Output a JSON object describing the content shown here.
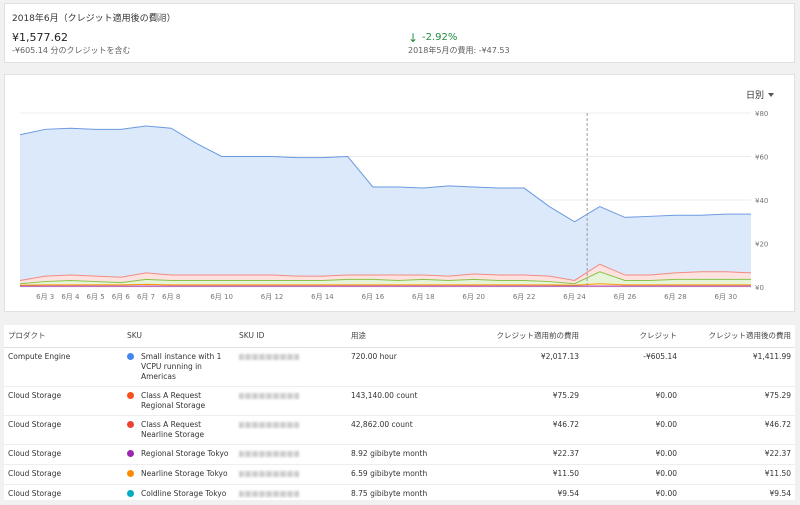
{
  "summary": {
    "title": "2018年6月（クレジット適用後の費用）",
    "help_icon": "help-icon",
    "total": "¥1,577.62",
    "credit_note": "-¥605.14 分のクレジットを含む",
    "change": "-2.92%",
    "change_icon": "arrow-down-icon",
    "previous": "2018年5月の費用: -¥47.53"
  },
  "chart": {
    "granularity_label": "日別",
    "forecast_divider_x": 24.5
  },
  "chart_data": {
    "type": "area",
    "x": [
      2,
      3,
      4,
      5,
      6,
      7,
      8,
      9,
      10,
      11,
      12,
      13,
      14,
      15,
      16,
      17,
      18,
      19,
      20,
      21,
      22,
      23,
      24,
      25,
      26,
      27,
      28,
      29,
      30,
      31
    ],
    "x_tick_labels": [
      "6月 3",
      "6月 4",
      "6月 5",
      "6月 6",
      "6月 7",
      "6月 8",
      "6月 10",
      "6月 12",
      "6月 14",
      "6月 16",
      "6月 18",
      "6月 20",
      "6月 22",
      "6月 24",
      "6月 26",
      "6月 28",
      "6月 30"
    ],
    "x_tick_values": [
      3,
      4,
      5,
      6,
      7,
      8,
      10,
      12,
      14,
      16,
      18,
      20,
      22,
      24,
      26,
      28,
      30
    ],
    "ylim": [
      0,
      80
    ],
    "y_ticks": [
      0,
      20,
      40,
      60,
      80
    ],
    "y_tick_labels": [
      "¥0",
      "¥20",
      "¥40",
      "¥60",
      "¥80"
    ],
    "series": [
      {
        "color": "#6b9ae0",
        "fill": "#dce9fb",
        "values": [
          70,
          72.5,
          73,
          72.5,
          72.5,
          74,
          73,
          66,
          60,
          60,
          60,
          59.5,
          59.5,
          60,
          46,
          46,
          45.5,
          46.5,
          46,
          45.5,
          45.5,
          37,
          30,
          37,
          32,
          32.5,
          33,
          33,
          33.5,
          33.5
        ]
      },
      {
        "color": "#f28b82",
        "fill": "#fde2df",
        "values": [
          3,
          5,
          5.5,
          5,
          4.5,
          6.5,
          5.5,
          5.5,
          5.5,
          5.5,
          5.5,
          5,
          5,
          5.5,
          5.5,
          5.5,
          5.5,
          5,
          6,
          5.5,
          5.5,
          5,
          3,
          10.5,
          5.5,
          5.5,
          6.5,
          7,
          7,
          6.5
        ]
      },
      {
        "color": "#8bc34a",
        "fill": "#e6f4d7",
        "values": [
          1.5,
          2.5,
          3,
          2.5,
          2,
          3.5,
          3,
          3,
          3,
          3,
          3,
          3,
          3,
          3.5,
          3.5,
          3,
          3.5,
          3,
          3.5,
          3,
          3,
          2.5,
          1.5,
          7,
          3,
          3,
          3.5,
          3.5,
          3.5,
          3.5
        ]
      },
      {
        "color": "#ff9800",
        "fill": "#fff3e0",
        "values": [
          0.8,
          1,
          1,
          1,
          1,
          1.2,
          1,
          1,
          1,
          1,
          1,
          1,
          1,
          1,
          1,
          1,
          1,
          1,
          1,
          1,
          1,
          1,
          0.8,
          1.5,
          1,
          1,
          1,
          1,
          1,
          1
        ]
      },
      {
        "color": "#9c27b0",
        "fill": "none",
        "values": [
          0.4,
          0.4,
          0.4,
          0.4,
          0.4,
          0.4,
          0.4,
          0.4,
          0.4,
          0.4,
          0.4,
          0.4,
          0.4,
          0.4,
          0.4,
          0.4,
          0.4,
          0.4,
          0.4,
          0.4,
          0.4,
          0.4,
          0.4,
          0.4,
          0.4,
          0.4,
          0.4,
          0.4,
          0.4,
          0.4
        ]
      }
    ]
  },
  "table": {
    "headers": [
      "プロダクト",
      "SKU",
      "SKU ID",
      "用途",
      "クレジット適用前の費用",
      "クレジット",
      "クレジット適用後の費用"
    ],
    "rows": [
      {
        "product": "Compute Engine",
        "dot": "#4285f4",
        "sku": "Small instance with 1 VCPU running in Americas",
        "usage": "720.00 hour",
        "before": "¥2,017.13",
        "credit": "-¥605.14",
        "after": "¥1,411.99"
      },
      {
        "product": "Cloud Storage",
        "dot": "#f4511e",
        "sku": "Class A Request Regional Storage",
        "usage": "143,140.00 count",
        "before": "¥75.29",
        "credit": "¥0.00",
        "after": "¥75.29"
      },
      {
        "product": "Cloud Storage",
        "dot": "#ea4335",
        "sku": "Class A Request Nearline Storage",
        "usage": "42,862.00 count",
        "before": "¥46.72",
        "credit": "¥0.00",
        "after": "¥46.72"
      },
      {
        "product": "Cloud Storage",
        "dot": "#9c27b0",
        "sku": "Regional Storage Tokyo",
        "usage": "8.92 gibibyte month",
        "before": "¥22.37",
        "credit": "¥0.00",
        "after": "¥22.37"
      },
      {
        "product": "Cloud Storage",
        "dot": "#fb8c00",
        "sku": "Nearline Storage Tokyo",
        "usage": "6.59 gibibyte month",
        "before": "¥11.50",
        "credit": "¥0.00",
        "after": "¥11.50"
      },
      {
        "product": "Cloud Storage",
        "dot": "#00acc1",
        "sku": "Coldline Storage Tokyo",
        "usage": "8.75 gibibyte month",
        "before": "¥9.54",
        "credit": "¥0.00",
        "after": "¥9.54"
      }
    ]
  }
}
